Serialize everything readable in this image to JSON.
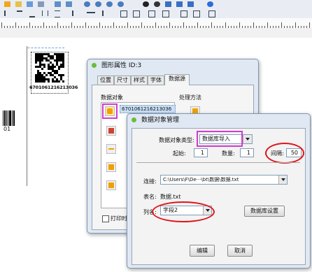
{
  "canvas": {
    "barcode_text": "6701061216213036",
    "barcode_digits": "01"
  },
  "graphic_props": {
    "title": "图形属性 ID:3",
    "tabs": [
      "位置",
      "尺寸",
      "样式",
      "字体",
      "数据源"
    ],
    "active_tab": "数据源",
    "data_object_label": "数据对象",
    "process_label": "处理方法",
    "data_item": "6701061216213036",
    "print_checkbox_label": "打印时"
  },
  "manager": {
    "title": "数据对象管理",
    "type_label": "数据对象类型:",
    "type_value": "数据库导入",
    "start_label": "起始:",
    "start_value": "1",
    "quantity_label": "数量:",
    "quantity_value": "1",
    "interval_label": "间隔:",
    "interval_value": "50",
    "connect_label": "连接:",
    "connect_value": "C:\\Users\\F\\De···\\bt\\数据\\数据.txt",
    "table_label": "表名:",
    "table_value": "数据.txt",
    "column_label": "列名:",
    "column_value": "字段2",
    "db_settings_button": "数据库设置",
    "edit_button": "编辑",
    "cancel_button": "取消"
  },
  "colors": {
    "highlight_red": "#e0141b",
    "highlight_magenta": "#d23bd0"
  }
}
